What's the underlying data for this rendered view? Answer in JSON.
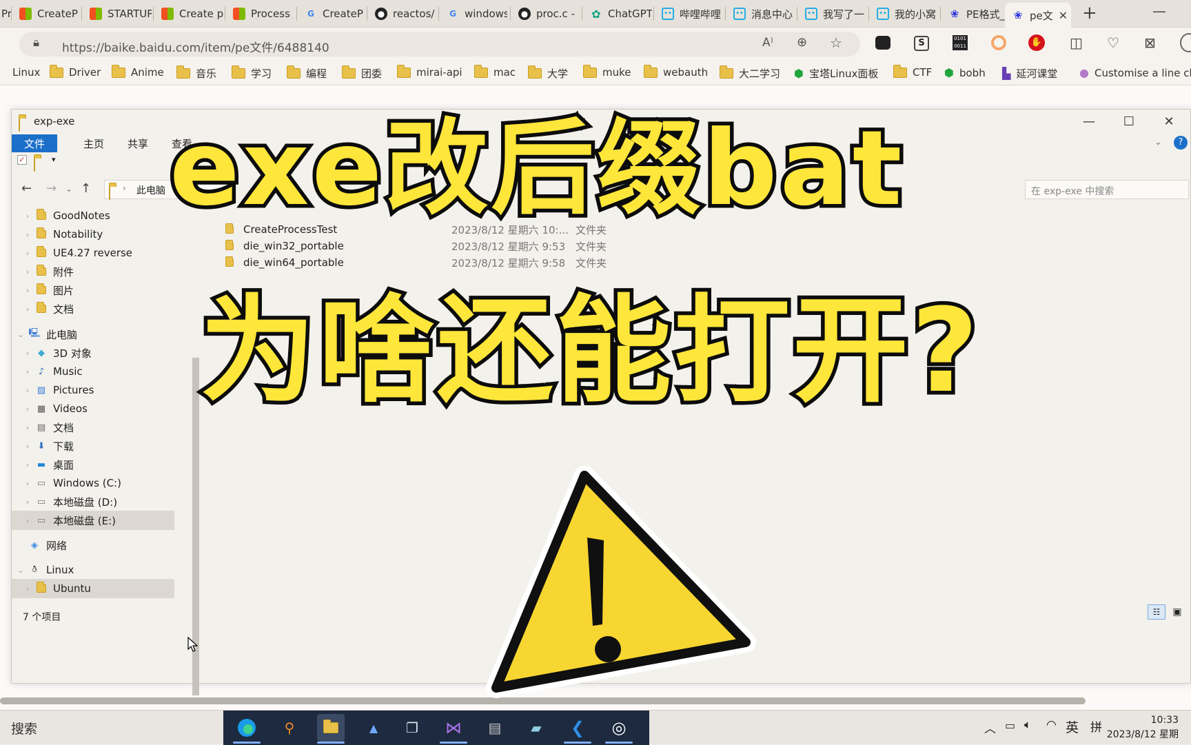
{
  "browser": {
    "tabs": [
      {
        "label": "Pr",
        "icon": "ms-icon"
      },
      {
        "label": "CreateP",
        "icon": "ms-icon"
      },
      {
        "label": "STARTUP",
        "icon": "ms-icon"
      },
      {
        "label": "Create p",
        "icon": "ms-icon"
      },
      {
        "label": "Process",
        "icon": "ms-icon"
      },
      {
        "label": "CreateP",
        "icon": "google-icon"
      },
      {
        "label": "reactos/",
        "icon": "github-icon"
      },
      {
        "label": "windows",
        "icon": "google-icon"
      },
      {
        "label": "proc.c -",
        "icon": "github-icon"
      },
      {
        "label": "ChatGPT",
        "icon": "chatgpt-icon"
      },
      {
        "label": "哔哩哔哩",
        "icon": "bilibili-icon"
      },
      {
        "label": "消息中心",
        "icon": "bilibili-icon"
      },
      {
        "label": "我写了一",
        "icon": "bilibili-icon"
      },
      {
        "label": "我的小窝",
        "icon": "bilibili-icon"
      },
      {
        "label": "PE格式_",
        "icon": "baidu-icon"
      },
      {
        "label": "pe文",
        "icon": "baidu-icon"
      }
    ],
    "url": "https://baike.baidu.com/item/pe文件/6488140",
    "bookmarks": [
      "Linux",
      "Driver",
      "Anime",
      "音乐",
      "学习",
      "编程",
      "团委",
      "mirai-api",
      "mac",
      "大学",
      "muke",
      "webauth",
      "大二学习",
      "宝塔Linux面板",
      "CTF",
      "bobh",
      "延河课堂",
      "Customise a line ch..."
    ]
  },
  "explorer": {
    "title": "exp-exe",
    "ribbon_tabs": [
      "文件",
      "主页",
      "共享",
      "查看"
    ],
    "breadcrumb": "此电脑",
    "search_placeholder": "在 exp-exe 中搜索",
    "nav": [
      {
        "label": "GoodNotes",
        "icon": "folder"
      },
      {
        "label": "Notability",
        "icon": "folder"
      },
      {
        "label": "UE4.27 reverse",
        "icon": "folder"
      },
      {
        "label": "附件",
        "icon": "folder"
      },
      {
        "label": "图片",
        "icon": "folder"
      },
      {
        "label": "文档",
        "icon": "folder"
      },
      {
        "label": "此电脑",
        "icon": "pc"
      },
      {
        "label": "3D 对象",
        "icon": "cube"
      },
      {
        "label": "Music",
        "icon": "music"
      },
      {
        "label": "Pictures",
        "icon": "picture"
      },
      {
        "label": "Videos",
        "icon": "video"
      },
      {
        "label": "文档",
        "icon": "doc"
      },
      {
        "label": "下载",
        "icon": "download"
      },
      {
        "label": "桌面",
        "icon": "desktop"
      },
      {
        "label": "Windows (C:)",
        "icon": "drive"
      },
      {
        "label": "本地磁盘 (D:)",
        "icon": "drive"
      },
      {
        "label": "本地磁盘 (E:)",
        "icon": "drive"
      },
      {
        "label": "网络",
        "icon": "network"
      },
      {
        "label": "Linux",
        "icon": "linux"
      },
      {
        "label": "Ubuntu",
        "icon": "folder"
      }
    ],
    "files": [
      {
        "name": "CreateProcessTest",
        "date": "2023/8/12 星期六 10:...",
        "type": "文件夹"
      },
      {
        "name": "die_win32_portable",
        "date": "2023/8/12 星期六 9:53",
        "type": "文件夹"
      },
      {
        "name": "die_win64_portable",
        "date": "2023/8/12 星期六 9:58",
        "type": "文件夹"
      }
    ],
    "status": "7 个项目"
  },
  "overlay": {
    "line1": "exe改后缀bat",
    "line2": "为啥还能打开?"
  },
  "taskbar": {
    "search": "搜索",
    "ime_lang": "英",
    "ime_mode": "拼",
    "time": "10:33",
    "date": "2023/8/12 星期"
  }
}
